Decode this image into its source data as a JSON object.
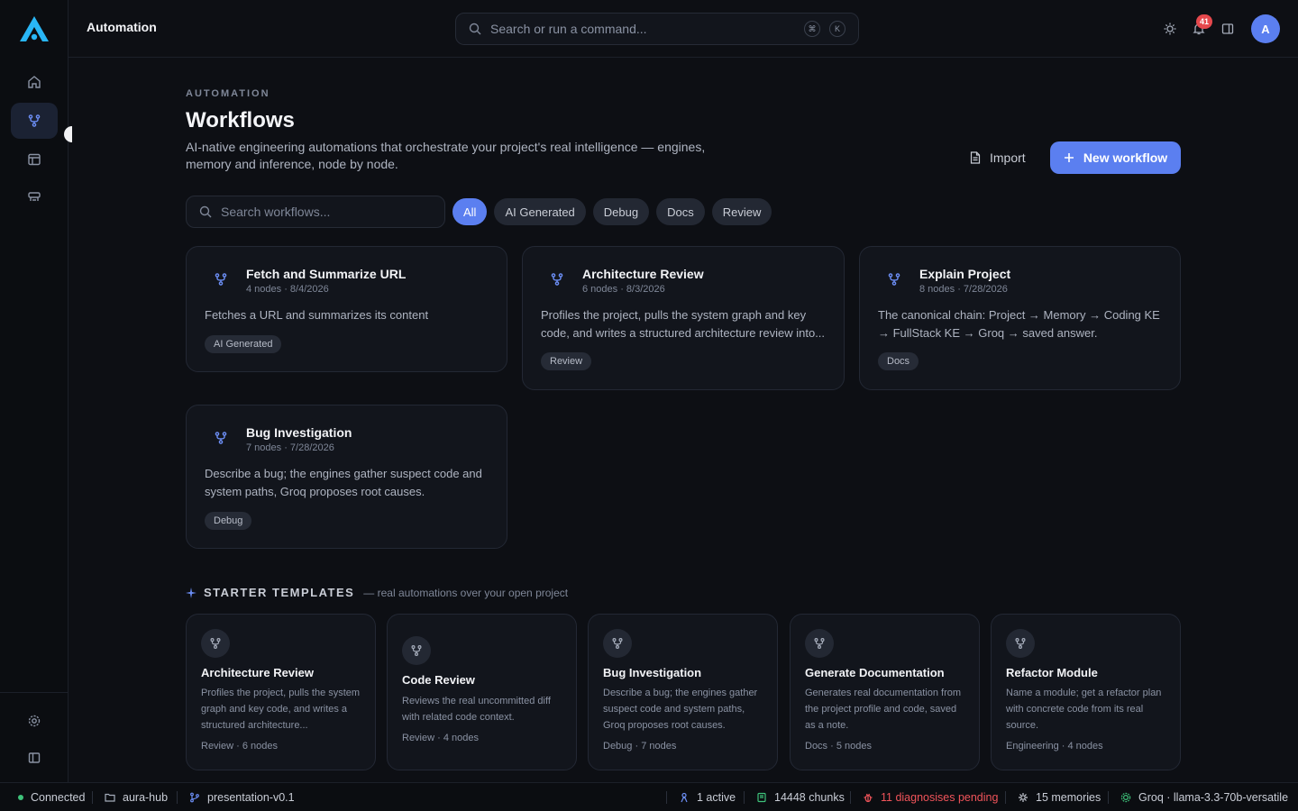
{
  "header": {
    "title": "Automation",
    "search_placeholder": "Search or run a command...",
    "kbd_1": "⌘",
    "kbd_2": "K",
    "notification_count": "41",
    "avatar_initial": "A"
  },
  "page": {
    "eyebrow": "AUTOMATION",
    "title": "Workflows",
    "description": "AI-native engineering automations that orchestrate your project's real intelligence — engines, memory and inference, node by node.",
    "import_label": "Import",
    "new_label": "New workflow",
    "search_placeholder": "Search workflows...",
    "filters": [
      "All",
      "AI Generated",
      "Debug",
      "Docs",
      "Review"
    ],
    "active_filter": "All"
  },
  "workflows": [
    {
      "title": "Fetch and Summarize URL",
      "meta": "4 nodes · 8/4/2026",
      "description": "Fetches a URL and summarizes its content",
      "tag": "AI Generated"
    },
    {
      "title": "Architecture Review",
      "meta": "6 nodes · 8/3/2026",
      "description": "Profiles the project, pulls the system graph and key code, and writes a structured architecture review into...",
      "tag": "Review"
    },
    {
      "title": "Explain Project",
      "meta": "8 nodes · 7/28/2026",
      "description": "The canonical chain: Project → Memory → Coding KE → FullStack KE → Groq → saved answer.",
      "tag": "Docs"
    },
    {
      "title": "Bug Investigation",
      "meta": "7 nodes · 7/28/2026",
      "description": "Describe a bug; the engines gather suspect code and system paths, Groq proposes root causes.",
      "tag": "Debug"
    }
  ],
  "starter": {
    "title": "STARTER TEMPLATES",
    "subtitle": "— real automations over your open project",
    "templates": [
      {
        "title": "Architecture Review",
        "description": "Profiles the project, pulls the system graph and key code, and writes a structured architecture...",
        "meta": "Review · 6 nodes"
      },
      {
        "title": "Code Review",
        "description": "Reviews the real uncommitted diff with related code context.",
        "meta": "Review · 4 nodes"
      },
      {
        "title": "Bug Investigation",
        "description": "Describe a bug; the engines gather suspect code and system paths, Groq proposes root causes.",
        "meta": "Debug · 7 nodes"
      },
      {
        "title": "Generate Documentation",
        "description": "Generates real documentation from the project profile and code, saved as a note.",
        "meta": "Docs · 5 nodes"
      },
      {
        "title": "Refactor Module",
        "description": "Name a module; get a refactor plan with concrete code from its real source.",
        "meta": "Engineering · 4 nodes"
      }
    ]
  },
  "status": {
    "connection": "Connected",
    "project": "aura-hub",
    "branch": "presentation-v0.1",
    "active": "1 active",
    "chunks": "14448 chunks",
    "diagnoses": "11 diagnosises pending",
    "memories": "15 memories",
    "model": "Groq · llama-3.3-70b-versatile"
  },
  "colors": {
    "accent": "#5b7ff0",
    "background": "#0d0f14",
    "card": "#12151c",
    "warning": "#e5484d",
    "success": "#3ec27a"
  }
}
